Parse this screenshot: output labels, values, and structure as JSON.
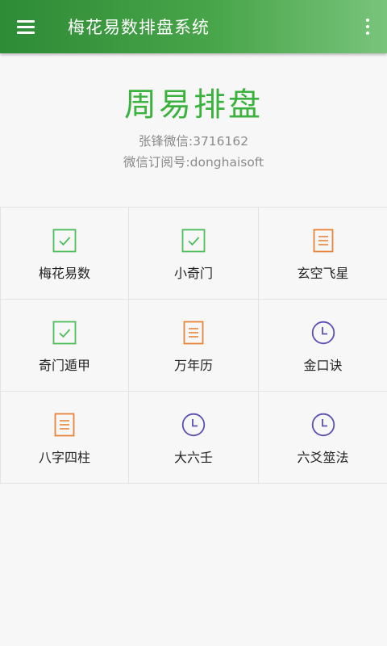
{
  "appbar": {
    "title": "梅花易数排盘系统",
    "menu_icon": "hamburger-icon",
    "more_icon": "more-vert-icon",
    "colors": {
      "start": "#2e8b36",
      "end": "#79c47c"
    }
  },
  "header": {
    "title": "周易排盘",
    "line1": "张锋微信:3716162",
    "line2": "微信订阅号:donghaisoft",
    "title_color": "#3cb23e"
  },
  "grid": [
    {
      "label": "梅花易数",
      "icon": "check-box-icon",
      "color": "#4dbf5a"
    },
    {
      "label": "小奇门",
      "icon": "check-box-icon",
      "color": "#4dbf5a"
    },
    {
      "label": "玄空飞星",
      "icon": "document-icon",
      "color": "#e8843a"
    },
    {
      "label": "奇门遁甲",
      "icon": "check-box-icon",
      "color": "#4dbf5a"
    },
    {
      "label": "万年历",
      "icon": "document-icon",
      "color": "#e8843a"
    },
    {
      "label": "金口诀",
      "icon": "clock-icon",
      "color": "#5a4fb3"
    },
    {
      "label": "八字四柱",
      "icon": "document-icon",
      "color": "#e8843a"
    },
    {
      "label": "大六壬",
      "icon": "clock-icon",
      "color": "#5a4fb3"
    },
    {
      "label": "六爻筮法",
      "icon": "clock-icon",
      "color": "#5a4fb3"
    }
  ]
}
